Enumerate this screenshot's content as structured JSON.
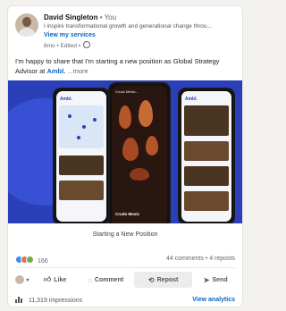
{
  "author": {
    "name": "David Singleton",
    "degree": "• You",
    "headline": "I inspire transformational growth and generational change throu...",
    "services_link": "View my services",
    "meta": "8mo • Edited •"
  },
  "post": {
    "text_before": "I'm happy to share that I'm starting a new position as Global Strategy Advisor at ",
    "company": "Ambl.",
    "more": "...more"
  },
  "banner": {
    "logo": "Ambl.",
    "dark_title": "Crudo Mexic...",
    "dark_bottom": "Crudo Mexic"
  },
  "caption": "Starting a New Position",
  "stats": {
    "reactions": "166",
    "comments_reposts": "44 comments • 4 reposts"
  },
  "actions": {
    "like": "Like",
    "comment": "Comment",
    "repost": "Repost",
    "send": "Send"
  },
  "footer": {
    "impressions": "11,319 impressions",
    "analytics": "View analytics"
  },
  "colors": {
    "link_blue": "#0a66c2",
    "banner_blue": "#2a3fb8"
  }
}
